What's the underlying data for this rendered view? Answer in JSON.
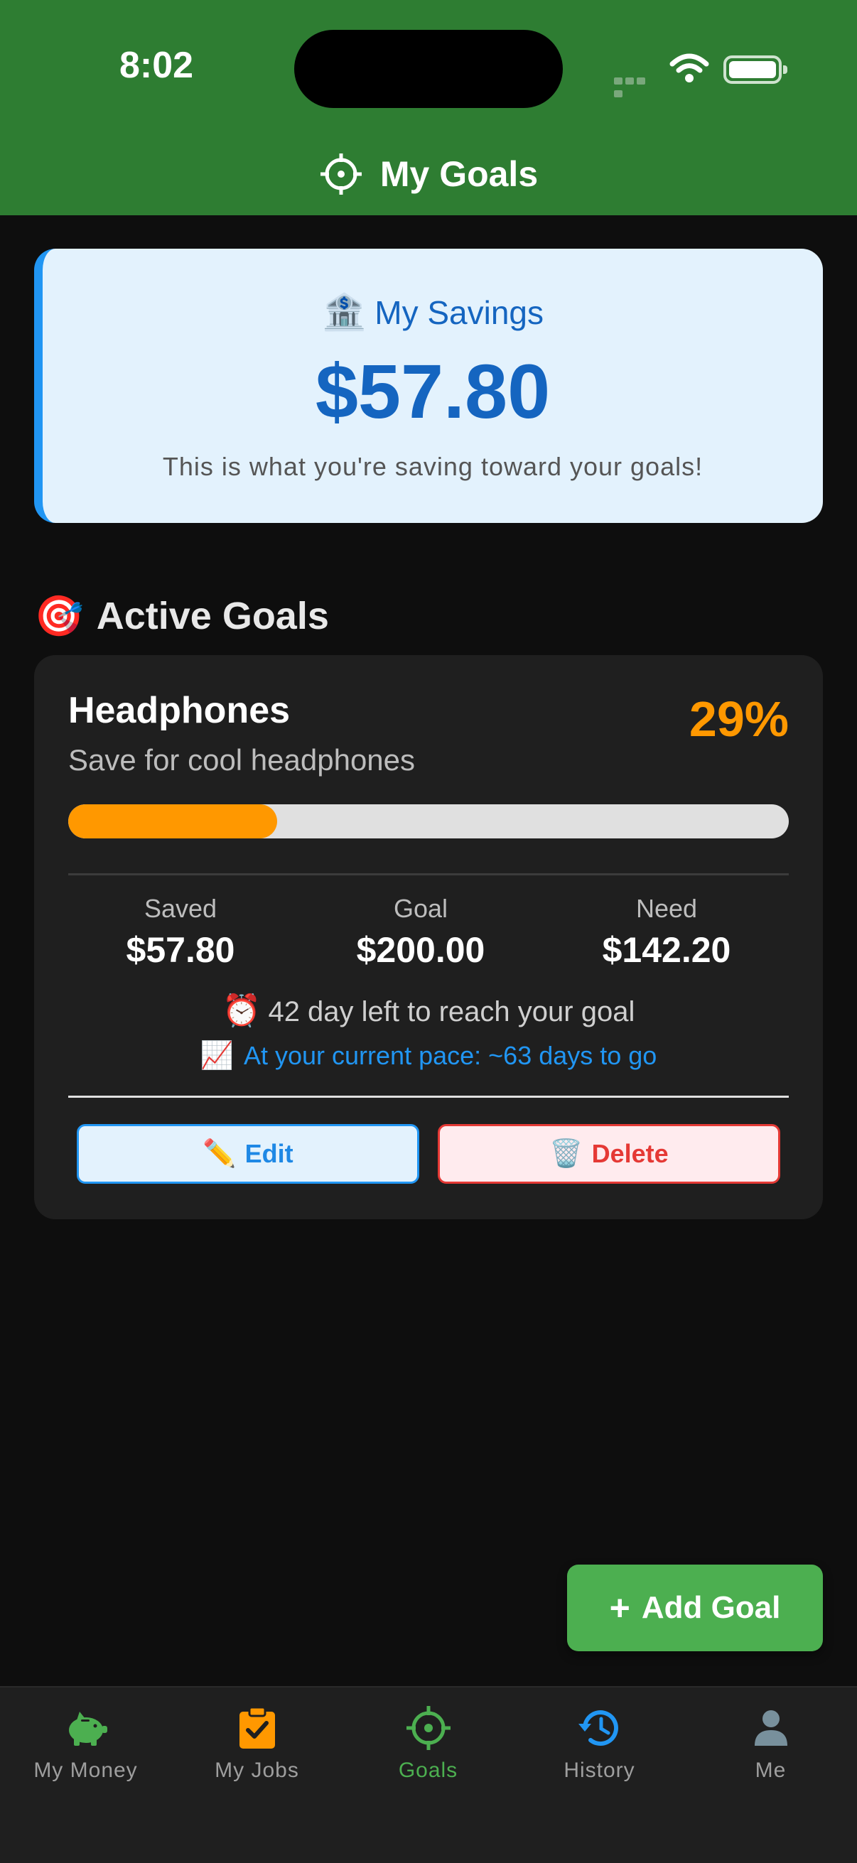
{
  "status_bar": {
    "time": "8:02"
  },
  "header": {
    "title": "My Goals",
    "icon": "crosshair-icon"
  },
  "savings": {
    "emoji": "🏦",
    "label": "My Savings",
    "amount": "$57.80",
    "subtitle": "This is what you're saving toward your goals!"
  },
  "active_goals": {
    "emoji": "🎯",
    "title": "Active Goals",
    "goals": [
      {
        "name": "Headphones",
        "description": "Save for cool headphones",
        "percent_label": "29%",
        "progress": 0.29,
        "saved_label": "Saved",
        "saved_value": "$57.80",
        "goal_label": "Goal",
        "goal_value": "$200.00",
        "need_label": "Need",
        "need_value": "$142.20",
        "days_emoji": "⏰",
        "days_left": "42 day left to reach your goal",
        "pace_emoji": "📈",
        "pace": "At your current pace: ~63 days to go",
        "edit_emoji": "✏️",
        "edit_label": "Edit",
        "delete_emoji": "🗑️",
        "delete_label": "Delete"
      }
    ]
  },
  "add_goal": {
    "plus": "+",
    "label": "Add Goal"
  },
  "nav": [
    {
      "label": "My Money",
      "icon": "piggy-bank-icon",
      "color": "#4caf50"
    },
    {
      "label": "My Jobs",
      "icon": "clipboard-check-icon",
      "color": "#ff9800"
    },
    {
      "label": "Goals",
      "icon": "crosshair-icon",
      "color": "#4caf50",
      "active": true
    },
    {
      "label": "History",
      "icon": "history-icon",
      "color": "#2196f3"
    },
    {
      "label": "Me",
      "icon": "person-icon",
      "color": "#78909c"
    }
  ],
  "colors": {
    "header": "#2e7d32",
    "accent_blue": "#2196f3",
    "accent_orange": "#ff9800",
    "accent_green": "#4caf50",
    "danger": "#e53935"
  }
}
